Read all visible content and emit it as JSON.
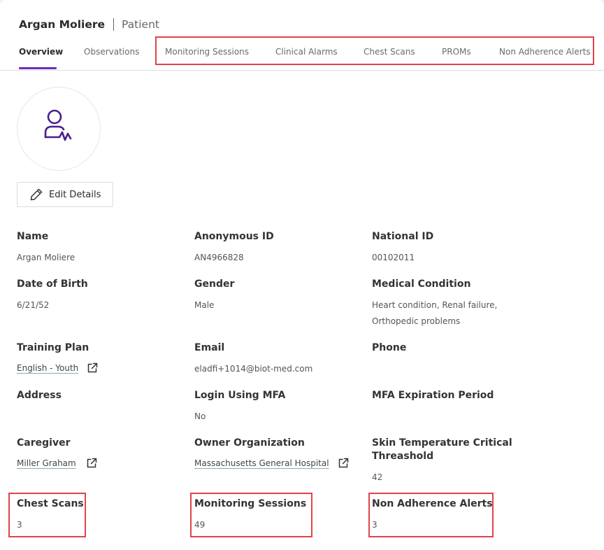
{
  "header": {
    "patient_name": "Argan Moliere",
    "entity_type": "Patient"
  },
  "tabs": [
    {
      "label": "Overview",
      "active": true
    },
    {
      "label": "Observations",
      "active": false
    },
    {
      "label": "Monitoring Sessions",
      "active": false
    },
    {
      "label": "Clinical Alarms",
      "active": false
    },
    {
      "label": "Chest Scans",
      "active": false
    },
    {
      "label": "PROMs",
      "active": false
    },
    {
      "label": "Non Adherence Alerts",
      "active": false
    }
  ],
  "actions": {
    "edit_details": "Edit Details"
  },
  "fields": {
    "name": {
      "label": "Name",
      "value": "Argan Moliere"
    },
    "anonymous_id": {
      "label": "Anonymous ID",
      "value": "AN4966828"
    },
    "national_id": {
      "label": "National ID",
      "value": "00102011"
    },
    "date_of_birth": {
      "label": "Date of Birth",
      "value": "6/21/52"
    },
    "gender": {
      "label": "Gender",
      "value": "Male"
    },
    "medical_condition": {
      "label": "Medical Condition",
      "value": "Heart condition, Renal failure, Orthopedic problems"
    },
    "training_plan": {
      "label": "Training Plan",
      "value": "English - Youth"
    },
    "email": {
      "label": "Email",
      "value": "eladfi+1014@biot-med.com"
    },
    "phone": {
      "label": "Phone",
      "value": ""
    },
    "address": {
      "label": "Address",
      "value": ""
    },
    "login_using_mfa": {
      "label": "Login Using MFA",
      "value": "No"
    },
    "mfa_expiration_period": {
      "label": "MFA Expiration Period",
      "value": ""
    },
    "caregiver": {
      "label": "Caregiver",
      "value": "Miller Graham"
    },
    "owner_organization": {
      "label": "Owner Organization",
      "value": "Massachusetts General Hospital"
    },
    "skin_temp_threshold": {
      "label": "Skin Temperature Critical Threashold",
      "value": "42"
    },
    "chest_scans": {
      "label": "Chest Scans",
      "value": "3"
    },
    "monitoring_sessions": {
      "label": "Monitoring Sessions",
      "value": "49"
    },
    "non_adherence_alerts": {
      "label": "Non Adherence Alerts",
      "value": "3"
    }
  },
  "icons": {
    "avatar": "patient-avatar-icon",
    "edit": "pencil-icon",
    "external_link": "external-link-icon"
  },
  "colors": {
    "accent": "#6b2cc2",
    "avatar_icon": "#4a1f8c",
    "highlight_box": "#e0434c"
  }
}
